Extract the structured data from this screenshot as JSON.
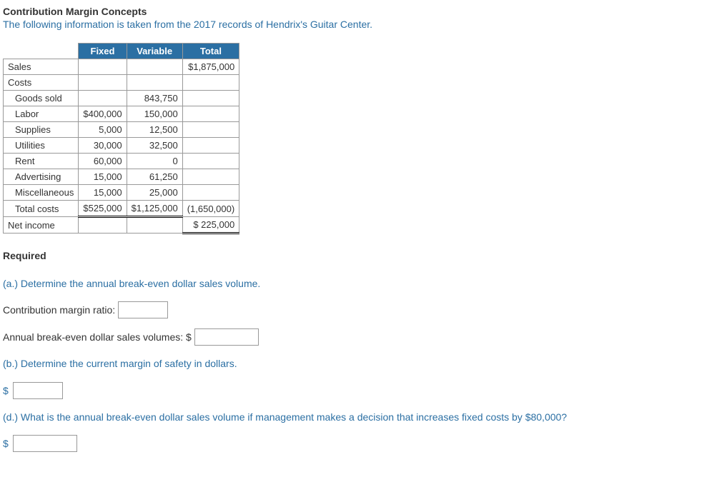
{
  "title": "Contribution Margin Concepts",
  "intro": "The following information is taken from the 2017 records of Hendrix's Guitar Center.",
  "table": {
    "headers": {
      "fixed": "Fixed",
      "variable": "Variable",
      "total": "Total"
    },
    "rows": {
      "sales": {
        "label": "Sales",
        "fixed": "",
        "variable": "",
        "total": "$1,875,000"
      },
      "costs": {
        "label": "Costs",
        "fixed": "",
        "variable": "",
        "total": ""
      },
      "goods_sold": {
        "label": "Goods sold",
        "fixed": "",
        "variable": "843,750",
        "total": ""
      },
      "labor": {
        "label": "Labor",
        "fixed": "$400,000",
        "variable": "150,000",
        "total": ""
      },
      "supplies": {
        "label": "Supplies",
        "fixed": "5,000",
        "variable": "12,500",
        "total": ""
      },
      "utilities": {
        "label": "Utilities",
        "fixed": "30,000",
        "variable": "32,500",
        "total": ""
      },
      "rent": {
        "label": "Rent",
        "fixed": "60,000",
        "variable": "0",
        "total": ""
      },
      "advertising": {
        "label": "Advertising",
        "fixed": "15,000",
        "variable": "61,250",
        "total": ""
      },
      "misc": {
        "label": "Miscellaneous",
        "fixed": "15,000",
        "variable": "25,000",
        "total": ""
      },
      "total_costs": {
        "label": "Total costs",
        "fixed": "$525,000",
        "variable": "$1,125,000",
        "total": "(1,650,000)"
      },
      "net_income": {
        "label": "Net income",
        "fixed": "",
        "variable": "",
        "total": "$ 225,000"
      }
    }
  },
  "required_label": "Required",
  "questions": {
    "a": {
      "prompt": "(a.) Determine the annual break-even dollar sales volume.",
      "cm_ratio_label": "Contribution margin ratio:",
      "breakeven_label": "Annual break-even dollar sales volumes: $"
    },
    "b": {
      "prompt": "(b.) Determine the current margin of safety in dollars."
    },
    "d": {
      "prompt": "(d.) What is the annual break-even dollar sales volume if management makes a decision that increases fixed costs by $80,000?"
    }
  },
  "dollar_sign": "$"
}
